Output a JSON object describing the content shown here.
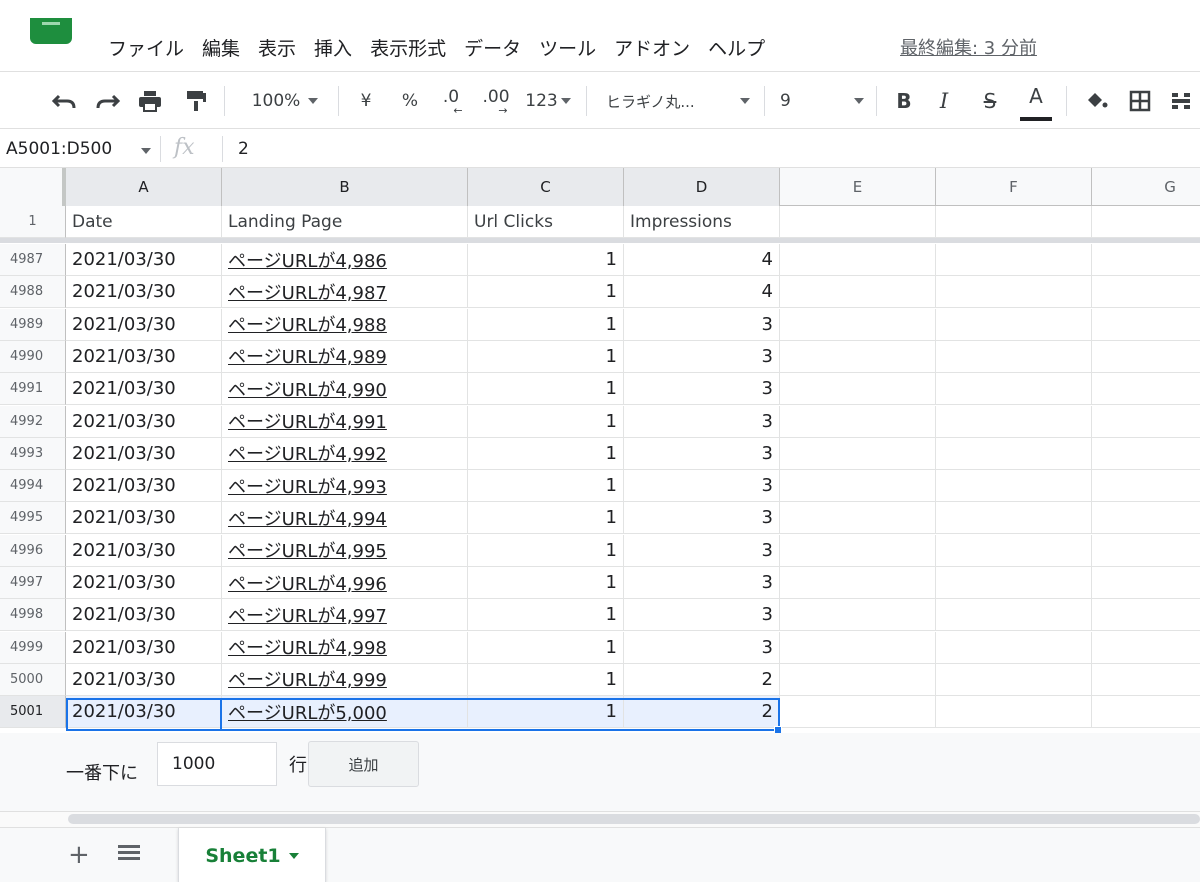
{
  "menu": {
    "items": [
      "ファイル",
      "編集",
      "表示",
      "挿入",
      "表示形式",
      "データ",
      "ツール",
      "アドオン",
      "ヘルプ"
    ],
    "last_edit": "最終編集: 3 分前"
  },
  "toolbar": {
    "zoom": "100%",
    "currency": "¥",
    "percent": "%",
    "decrease_decimal": ".0",
    "increase_decimal": ".00",
    "number_format": "123",
    "font": "ヒラギノ丸...",
    "font_size": "9",
    "bold": "B",
    "italic": "I",
    "strikethrough": "S",
    "text_color": "A"
  },
  "formula_bar": {
    "name_box": "A5001:D500",
    "fx": "fx",
    "value": "2"
  },
  "grid": {
    "columns": [
      "A",
      "B",
      "C",
      "D",
      "E",
      "F",
      "G"
    ],
    "header_row": {
      "row_number": "1",
      "cells": [
        "Date",
        "Landing Page",
        "Url Clicks",
        "Impressions"
      ]
    },
    "rows": [
      {
        "n": "4987",
        "date": "2021/03/30",
        "page": "ページURLが4,986",
        "clicks": "1",
        "impressions": "4"
      },
      {
        "n": "4988",
        "date": "2021/03/30",
        "page": "ページURLが4,987",
        "clicks": "1",
        "impressions": "4"
      },
      {
        "n": "4989",
        "date": "2021/03/30",
        "page": "ページURLが4,988",
        "clicks": "1",
        "impressions": "3"
      },
      {
        "n": "4990",
        "date": "2021/03/30",
        "page": "ページURLが4,989",
        "clicks": "1",
        "impressions": "3"
      },
      {
        "n": "4991",
        "date": "2021/03/30",
        "page": "ページURLが4,990",
        "clicks": "1",
        "impressions": "3"
      },
      {
        "n": "4992",
        "date": "2021/03/30",
        "page": "ページURLが4,991",
        "clicks": "1",
        "impressions": "3"
      },
      {
        "n": "4993",
        "date": "2021/03/30",
        "page": "ページURLが4,992",
        "clicks": "1",
        "impressions": "3"
      },
      {
        "n": "4994",
        "date": "2021/03/30",
        "page": "ページURLが4,993",
        "clicks": "1",
        "impressions": "3"
      },
      {
        "n": "4995",
        "date": "2021/03/30",
        "page": "ページURLが4,994",
        "clicks": "1",
        "impressions": "3"
      },
      {
        "n": "4996",
        "date": "2021/03/30",
        "page": "ページURLが4,995",
        "clicks": "1",
        "impressions": "3"
      },
      {
        "n": "4997",
        "date": "2021/03/30",
        "page": "ページURLが4,996",
        "clicks": "1",
        "impressions": "3"
      },
      {
        "n": "4998",
        "date": "2021/03/30",
        "page": "ページURLが4,997",
        "clicks": "1",
        "impressions": "3"
      },
      {
        "n": "4999",
        "date": "2021/03/30",
        "page": "ページURLが4,998",
        "clicks": "1",
        "impressions": "3"
      },
      {
        "n": "5000",
        "date": "2021/03/30",
        "page": "ページURLが4,999",
        "clicks": "1",
        "impressions": "2"
      },
      {
        "n": "5001",
        "date": "2021/03/30",
        "page": "ページURLが5,000",
        "clicks": "1",
        "impressions": "2"
      }
    ]
  },
  "add_rows": {
    "label": "一番下に",
    "count": "1000",
    "unit": "行",
    "button": "追加"
  },
  "sheets": {
    "active": "Sheet1"
  },
  "colors": {
    "brand_green": "#188038",
    "selection_blue": "#1a73e8",
    "selection_fill": "#e8f0fe"
  }
}
